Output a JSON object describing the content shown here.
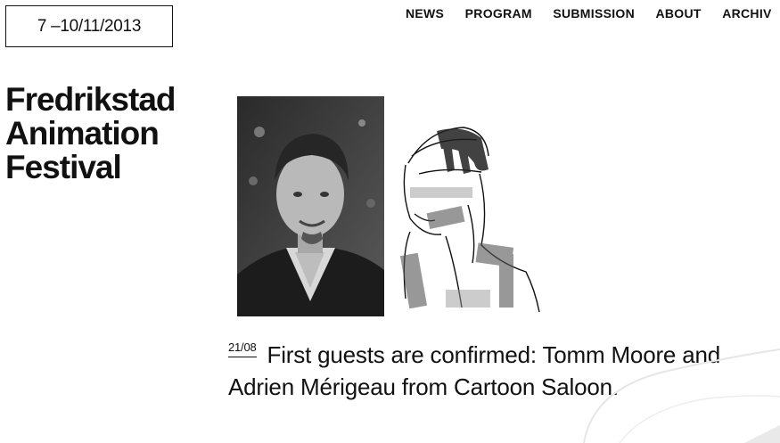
{
  "header": {
    "date_range": "7 –10/11/2013"
  },
  "nav": {
    "items": [
      {
        "label": "NEWS"
      },
      {
        "label": "PROGRAM"
      },
      {
        "label": "SUBMISSION"
      },
      {
        "label": "ABOUT"
      },
      {
        "label": "ARCHIV"
      }
    ]
  },
  "festival": {
    "title_lines": [
      "Fredrikstad",
      "Animation",
      "Festival"
    ]
  },
  "news": {
    "date": "21/08",
    "headline": "First guests are confirmed: Tomm Moore and Adrien Mérigeau from Cartoon Saloon."
  }
}
